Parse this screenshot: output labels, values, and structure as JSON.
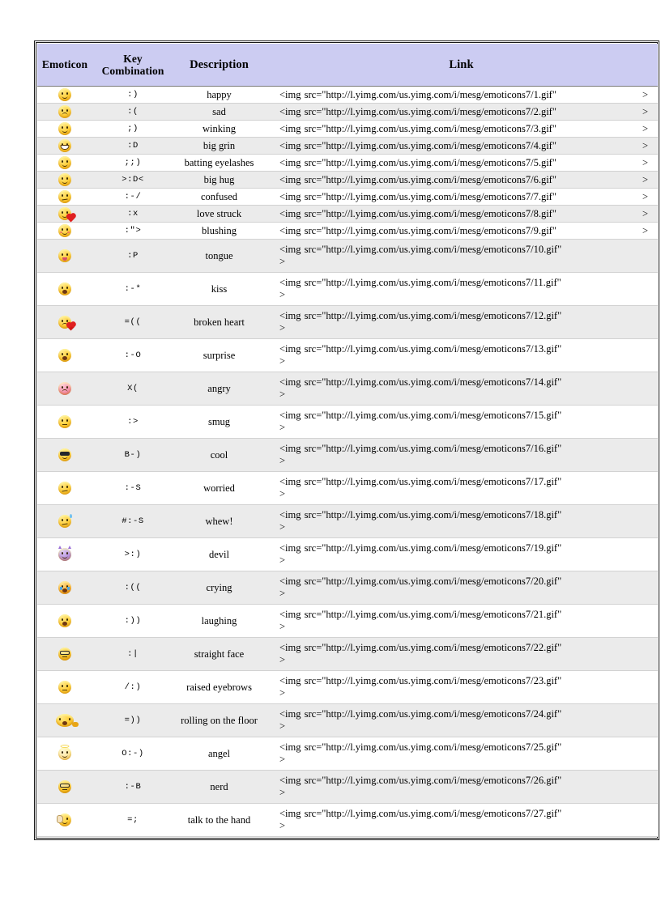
{
  "table": {
    "headers": {
      "emoticon": "Emoticon",
      "key_combination_line1": "Key",
      "key_combination_line2": "Combination",
      "description": "Description",
      "link": "Link"
    },
    "link_prefix": "<img  src=\"http://l.yimg.com/us.yimg.com/i/mesg/emoticons7/",
    "link_suffix": ".gif\"",
    "link_tail": ">",
    "rows": [
      {
        "n": 1,
        "key": ":)",
        "desc": "happy",
        "link": "<img  src=\"http://l.yimg.com/us.yimg.com/i/mesg/emoticons7/1.gif\"",
        "tail": ">",
        "emo": "happy"
      },
      {
        "n": 2,
        "key": ":(",
        "desc": "sad",
        "link": "<img  src=\"http://l.yimg.com/us.yimg.com/i/mesg/emoticons7/2.gif\"",
        "tail": ">",
        "emo": "sad"
      },
      {
        "n": 3,
        "key": ";)",
        "desc": "winking",
        "link": "<img  src=\"http://l.yimg.com/us.yimg.com/i/mesg/emoticons7/3.gif\"",
        "tail": ">",
        "emo": "winking"
      },
      {
        "n": 4,
        "key": ":D",
        "desc": "big grin",
        "link": "<img  src=\"http://l.yimg.com/us.yimg.com/i/mesg/emoticons7/4.gif\"",
        "tail": ">",
        "emo": "big-grin"
      },
      {
        "n": 5,
        "key": ";;)",
        "desc": "batting eyelashes",
        "link": "<img  src=\"http://l.yimg.com/us.yimg.com/i/mesg/emoticons7/5.gif\"",
        "tail": ">",
        "emo": "batting-eyelashes"
      },
      {
        "n": 6,
        "key": ">:D<",
        "desc": "big hug",
        "link": "<img  src=\"http://l.yimg.com/us.yimg.com/i/mesg/emoticons7/6.gif\"",
        "tail": ">",
        "emo": "big-hug"
      },
      {
        "n": 7,
        "key": ":-/",
        "desc": "confused",
        "link": "<img  src=\"http://l.yimg.com/us.yimg.com/i/mesg/emoticons7/7.gif\"",
        "tail": ">",
        "emo": "confused"
      },
      {
        "n": 8,
        "key": ":x",
        "desc": "love struck",
        "link": "<img  src=\"http://l.yimg.com/us.yimg.com/i/mesg/emoticons7/8.gif\"",
        "tail": ">",
        "emo": "love-struck"
      },
      {
        "n": 9,
        "key": ":\">",
        "desc": "blushing",
        "link": "<img  src=\"http://l.yimg.com/us.yimg.com/i/mesg/emoticons7/9.gif\"",
        "tail": ">",
        "emo": "blushing"
      },
      {
        "n": 10,
        "key": ":P",
        "desc": "tongue",
        "link": "<img  src=\"http://l.yimg.com/us.yimg.com/i/mesg/emoticons7/10.gif\"",
        "tail": ">",
        "emo": "tongue"
      },
      {
        "n": 11,
        "key": ":-*",
        "desc": "kiss",
        "link": "<img  src=\"http://l.yimg.com/us.yimg.com/i/mesg/emoticons7/11.gif\"",
        "tail": ">",
        "emo": "kiss"
      },
      {
        "n": 12,
        "key": "=((",
        "desc": "broken heart",
        "link": "<img  src=\"http://l.yimg.com/us.yimg.com/i/mesg/emoticons7/12.gif\"",
        "tail": ">",
        "emo": "broken-heart"
      },
      {
        "n": 13,
        "key": ":-O",
        "desc": "surprise",
        "link": "<img  src=\"http://l.yimg.com/us.yimg.com/i/mesg/emoticons7/13.gif\"",
        "tail": ">",
        "emo": "surprise"
      },
      {
        "n": 14,
        "key": "X(",
        "desc": "angry",
        "link": "<img  src=\"http://l.yimg.com/us.yimg.com/i/mesg/emoticons7/14.gif\"",
        "tail": ">",
        "emo": "angry"
      },
      {
        "n": 15,
        "key": ":>",
        "desc": "smug",
        "link": "<img  src=\"http://l.yimg.com/us.yimg.com/i/mesg/emoticons7/15.gif\"",
        "tail": ">",
        "emo": "smug"
      },
      {
        "n": 16,
        "key": "B-)",
        "desc": "cool",
        "link": "<img  src=\"http://l.yimg.com/us.yimg.com/i/mesg/emoticons7/16.gif\"",
        "tail": ">",
        "emo": "cool"
      },
      {
        "n": 17,
        "key": ":-S",
        "desc": "worried",
        "link": "<img  src=\"http://l.yimg.com/us.yimg.com/i/mesg/emoticons7/17.gif\"",
        "tail": ">",
        "emo": "worried"
      },
      {
        "n": 18,
        "key": "#:-S",
        "desc": "whew!",
        "link": "<img  src=\"http://l.yimg.com/us.yimg.com/i/mesg/emoticons7/18.gif\"",
        "tail": ">",
        "emo": "whew"
      },
      {
        "n": 19,
        "key": ">:)",
        "desc": "devil",
        "link": "<img  src=\"http://l.yimg.com/us.yimg.com/i/mesg/emoticons7/19.gif\"",
        "tail": ">",
        "emo": "devil"
      },
      {
        "n": 20,
        "key": ":((",
        "desc": "crying",
        "link": "<img  src=\"http://l.yimg.com/us.yimg.com/i/mesg/emoticons7/20.gif\"",
        "tail": ">",
        "emo": "crying"
      },
      {
        "n": 21,
        "key": ":))",
        "desc": "laughing",
        "link": "<img  src=\"http://l.yimg.com/us.yimg.com/i/mesg/emoticons7/21.gif\"",
        "tail": ">",
        "emo": "laughing"
      },
      {
        "n": 22,
        "key": ":|",
        "desc": "straight face",
        "link": "<img  src=\"http://l.yimg.com/us.yimg.com/i/mesg/emoticons7/22.gif\"",
        "tail": ">",
        "emo": "straight-face"
      },
      {
        "n": 23,
        "key": "/:)",
        "desc": "raised eyebrows",
        "link": "<img  src=\"http://l.yimg.com/us.yimg.com/i/mesg/emoticons7/23.gif\"",
        "tail": ">",
        "emo": "raised-eyebrows"
      },
      {
        "n": 24,
        "key": "=))",
        "desc": "rolling on the floor",
        "link": "<img  src=\"http://l.yimg.com/us.yimg.com/i/mesg/emoticons7/24.gif\"",
        "tail": ">",
        "emo": "rolling-on-the-floor"
      },
      {
        "n": 25,
        "key": "O:-)",
        "desc": "angel",
        "link": "<img  src=\"http://l.yimg.com/us.yimg.com/i/mesg/emoticons7/25.gif\"",
        "tail": ">",
        "emo": "angel"
      },
      {
        "n": 26,
        "key": ":-B",
        "desc": "nerd",
        "link": "<img  src=\"http://l.yimg.com/us.yimg.com/i/mesg/emoticons7/26.gif\"",
        "tail": ">",
        "emo": "nerd"
      },
      {
        "n": 27,
        "key": "=;",
        "desc": "talk to the hand",
        "link": "<img  src=\"http://l.yimg.com/us.yimg.com/i/mesg/emoticons7/27.gif\"",
        "tail": ">",
        "emo": "talk-to-the-hand"
      }
    ]
  },
  "colors": {
    "header_background": "#ccccf2",
    "band_background": "#ebebeb",
    "page_background": "#ffffff",
    "border": "#1a1a1a",
    "row_divider": "#d2d2d2",
    "emoticon_yellow": "#ffcc33",
    "emoticon_pink": "#f58aa8",
    "emoticon_purple": "#b48fe0",
    "heart_red": "#e02020"
  }
}
